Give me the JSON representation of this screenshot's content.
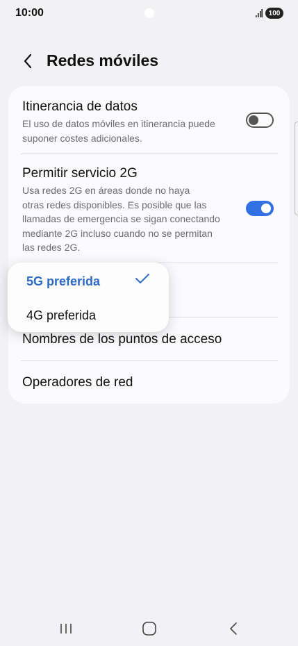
{
  "status_bar": {
    "time": "10:00",
    "battery": "100",
    "signal_icon": "signal-bars-icon"
  },
  "header": {
    "title": "Redes móviles",
    "back_icon": "chevron-left-icon"
  },
  "settings": {
    "roaming": {
      "title": "Itinerancia de datos",
      "description_lines": [
        "El uso de datos móviles en itinerancia puede",
        "suponer costes adicionales."
      ],
      "enabled": false
    },
    "allow_2g": {
      "title": "Permitir servicio 2G",
      "description_lines": [
        "Usa redes 2G en áreas donde no haya",
        "otras redes disponibles. Es posible que las",
        "llamadas de emergencia se sigan conectando",
        "mediante 2G incluso cuando no se permitan",
        "las redes 2G."
      ],
      "enabled": true
    },
    "apn": {
      "title": "Nombres de los puntos de acceso"
    },
    "operators": {
      "title": "Operadores de red"
    }
  },
  "network_mode_popup": {
    "options": [
      "5G preferida",
      "4G preferida"
    ],
    "selected": "5G preferida"
  },
  "colors": {
    "accent": "#3370e6",
    "selected_text": "#2f6ac4",
    "background": "#f2f2f5",
    "card": "#fbfbfd"
  },
  "nav_bar": {
    "recents_icon": "recents-icon",
    "home_icon": "home-icon",
    "back_icon": "back-icon"
  }
}
